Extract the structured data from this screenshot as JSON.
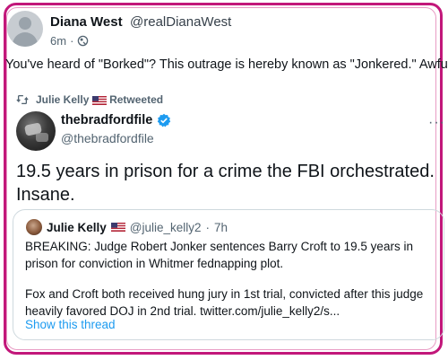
{
  "outer_post": {
    "author_name": "Diana West",
    "author_handle": "@realDianaWest",
    "timestamp": "6m",
    "separator": "·",
    "text": "You've heard of \"Borked\"? This outrage is hereby known as \"Jonkered.\" Awful."
  },
  "retweet": {
    "retweeted_by": "Julie Kelly",
    "retweeted_label": "Retweeted",
    "author_name": "thebradfordfile",
    "author_handle": "@thebradfordfile",
    "text": "19.5 years in prison for a crime the FBI orchestrated. Insane."
  },
  "quoted_tweet": {
    "author_name": "Julie Kelly",
    "author_handle": "@julie_kelly2",
    "separator": "·",
    "timestamp": "7h",
    "text_para1": "BREAKING: Judge Robert Jonker sentences Barry Croft to 19.5 years in prison for conviction in Whitmer fednapping plot.",
    "text_para2": "Fox and Croft both received hung jury in 1st trial, convicted after this judge heavily favored DOJ in 2nd trial. twitter.com/julie_kelly2/s...",
    "show_thread_label": "Show this thread"
  },
  "more_menu_glyph": "···",
  "colors": {
    "highlight_frame": "#c2177a",
    "link_blue": "#1d9bf0",
    "secondary_text": "#536471",
    "verified_blue": "#1d9bf0"
  },
  "icons": {
    "outer_avatar": "default-avatar-icon",
    "audience": "globe-icon",
    "retweet": "retweet-icon",
    "flag": "us-flag-icon",
    "verified": "verified-badge-icon",
    "more": "more-options-icon"
  }
}
